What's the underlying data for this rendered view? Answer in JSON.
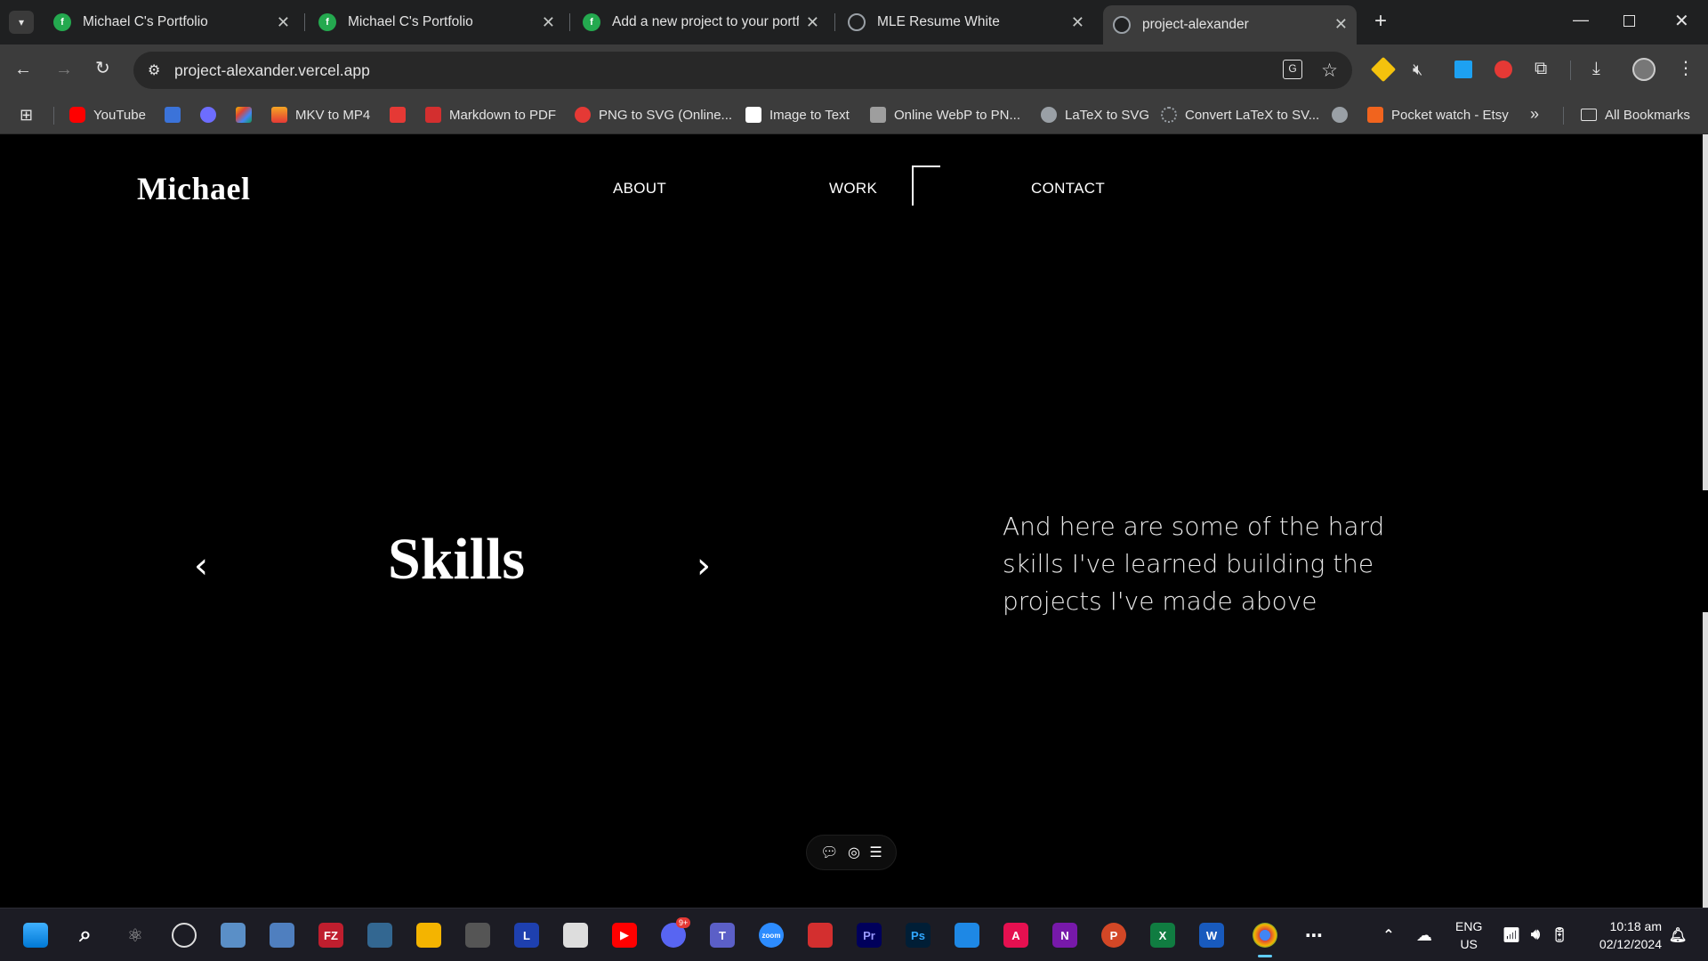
{
  "browser": {
    "tabs": [
      {
        "title": "Michael C's Portfolio",
        "icon": "framer-icon"
      },
      {
        "title": "Michael C's Portfolio",
        "icon": "framer-icon"
      },
      {
        "title": "Add a new project to your portf",
        "icon": "framer-icon"
      },
      {
        "title": "MLE Resume White",
        "icon": "globe-icon"
      },
      {
        "title": "project-alexander",
        "icon": "globe-icon",
        "active": true
      }
    ],
    "url": "project-alexander.vercel.app",
    "bookmarks": [
      {
        "label": "YouTube",
        "color": "#ff0000"
      },
      {
        "label": "",
        "color": "#3b73d9"
      },
      {
        "label": "",
        "color": "#6d6dff"
      },
      {
        "label": "",
        "color": "#f4b400"
      },
      {
        "label": "MKV to MP4",
        "color": "#f5a623"
      },
      {
        "label": "",
        "color": "#e53935"
      },
      {
        "label": "Markdown to PDF",
        "color": "#d32f2f"
      },
      {
        "label": "PNG to SVG (Online...",
        "color": "#e53935"
      },
      {
        "label": "Image to Text",
        "color": "#ffffff"
      },
      {
        "label": "Online WebP to PN...",
        "color": "#9e9e9e"
      },
      {
        "label": "LaTeX to SVG",
        "color": "#9aa0a6"
      },
      {
        "label": "Convert LaTeX to SV...",
        "color": "#3c3c3c"
      },
      {
        "label": "",
        "color": "#9aa0a6"
      },
      {
        "label": "Pocket watch - Etsy",
        "color": "#f1641e"
      }
    ],
    "all_bookmarks": "All Bookmarks"
  },
  "page": {
    "logo": "Michael",
    "nav": [
      "ABOUT",
      "WORK",
      "CONTACT"
    ],
    "section_title": "Skills",
    "prev_arrow": "‹",
    "next_arrow": "›",
    "description": "And here are some of the hard skills I've learned building the projects I've made above"
  },
  "taskbar": {
    "lang_top": "ENG",
    "lang_bottom": "US",
    "time": "10:18 am",
    "date": "02/12/2024",
    "discord_badge": "9+"
  }
}
